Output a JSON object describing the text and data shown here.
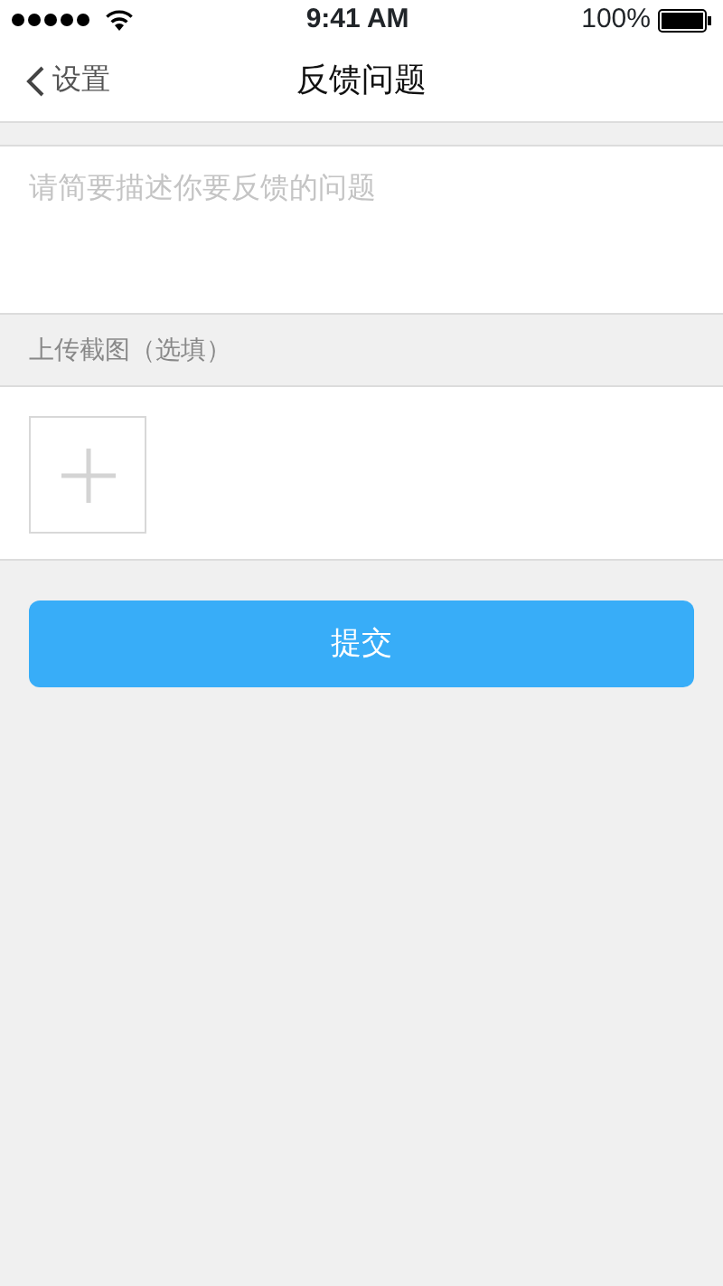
{
  "status_bar": {
    "time": "9:41 AM",
    "battery": "100%"
  },
  "nav": {
    "back": "设置",
    "title": "反馈问题"
  },
  "feedback": {
    "placeholder": "请简要描述你要反馈的问题"
  },
  "upload": {
    "label": "上传截图（选填）"
  },
  "submit": "提交"
}
